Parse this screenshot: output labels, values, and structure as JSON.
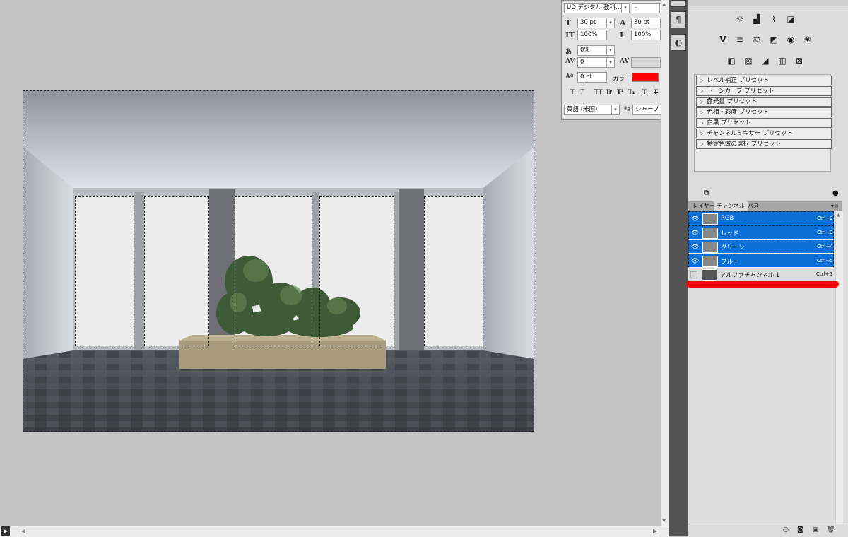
{
  "character_panel": {
    "font_family": "UD デジタル 教科…",
    "font_style": "-",
    "font_size": "30 pt",
    "leading": "30 pt",
    "vertical_scale": "100%",
    "horizontal_scale": "100%",
    "tsume": "0%",
    "kerning": "0",
    "baseline_shift": "0 pt",
    "color_label": "カラー：",
    "color_value": "#ff0000",
    "language": "英語 (米国)",
    "antialias_label": "ªa",
    "antialias": "シャープ",
    "style_buttons": [
      "T",
      "T",
      "TT",
      "Tr",
      "T¹",
      "T₁",
      "T",
      "T"
    ]
  },
  "adjustments": {
    "presets": [
      "レベル補正 プリセット",
      "トーンカーブ プリセット",
      "露光量 プリセット",
      "色相・彩度 プリセット",
      "白黒 プリセット",
      "チャンネルミキサー プリセット",
      "特定色域の選択 プリセット"
    ]
  },
  "panel_tabs": [
    "レイヤー",
    "チャンネル",
    "パス"
  ],
  "channels": [
    {
      "name": "RGB",
      "shortcut": "Ctrl+2",
      "visible": true,
      "selected": true
    },
    {
      "name": "レッド",
      "shortcut": "Ctrl+3",
      "visible": true,
      "selected": true
    },
    {
      "name": "グリーン",
      "shortcut": "Ctrl+4",
      "visible": true,
      "selected": true
    },
    {
      "name": "ブルー",
      "shortcut": "Ctrl+5",
      "visible": true,
      "selected": true
    },
    {
      "name": "アルファチャンネル 1",
      "shortcut": "Ctrl+6",
      "visible": false,
      "selected": false
    }
  ],
  "colors": {
    "selection_blue": "#0a6fd6",
    "annotation_red": "#ff0000"
  }
}
